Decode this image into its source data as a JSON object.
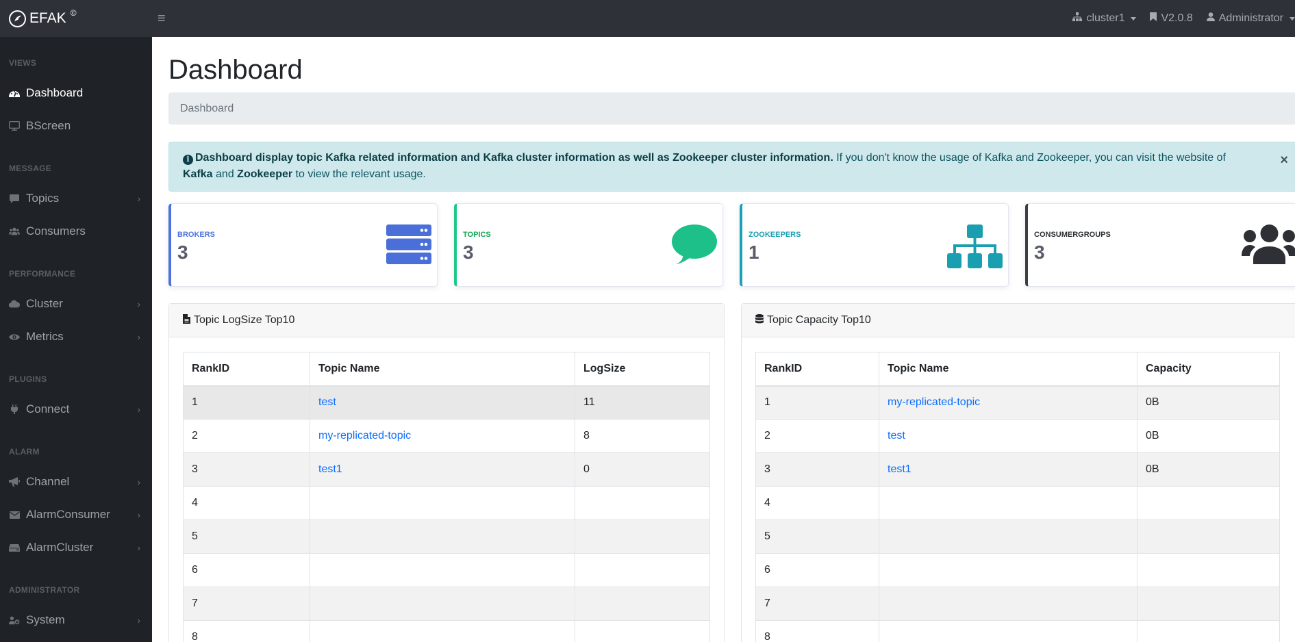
{
  "header": {
    "brand": "EFAK",
    "brand_mark": "©",
    "menu_toggle_icon": "hamburger-icon",
    "cluster": "cluster1",
    "version": "V2.0.8",
    "user": "Administrator"
  },
  "sidebar": {
    "sections": [
      {
        "heading": "VIEWS",
        "items": [
          {
            "label": "Dashboard",
            "icon": "tachometer-icon",
            "active": true,
            "expandable": false
          },
          {
            "label": "BScreen",
            "icon": "desktop-icon",
            "active": false,
            "expandable": false
          }
        ]
      },
      {
        "heading": "MESSAGE",
        "items": [
          {
            "label": "Topics",
            "icon": "comment-icon",
            "active": false,
            "expandable": true
          },
          {
            "label": "Consumers",
            "icon": "users-icon",
            "active": false,
            "expandable": false
          }
        ]
      },
      {
        "heading": "PERFORMANCE",
        "items": [
          {
            "label": "Cluster",
            "icon": "cloud-icon",
            "active": false,
            "expandable": true
          },
          {
            "label": "Metrics",
            "icon": "eye-icon",
            "active": false,
            "expandable": true
          }
        ]
      },
      {
        "heading": "PLUGINS",
        "items": [
          {
            "label": "Connect",
            "icon": "plug-icon",
            "active": false,
            "expandable": true
          }
        ]
      },
      {
        "heading": "ALARM",
        "items": [
          {
            "label": "Channel",
            "icon": "bullhorn-icon",
            "active": false,
            "expandable": true
          },
          {
            "label": "AlarmConsumer",
            "icon": "envelope-icon",
            "active": false,
            "expandable": true
          },
          {
            "label": "AlarmCluster",
            "icon": "hdd-icon",
            "active": false,
            "expandable": true
          }
        ]
      },
      {
        "heading": "ADMINISTRATOR",
        "items": [
          {
            "label": "System",
            "icon": "user-cog-icon",
            "active": false,
            "expandable": true
          }
        ]
      }
    ]
  },
  "main": {
    "title": "Dashboard",
    "breadcrumb": "Dashboard",
    "alert": {
      "bold_intro": "Dashboard display topic Kafka related information and Kafka cluster information as well as Zookeeper cluster information.",
      "text_1": " If you don't know the usage of Kafka and Zookeeper, you can visit the website of ",
      "link_kafka": "Kafka",
      "text_2": " and ",
      "link_zookeeper": "Zookeeper",
      "text_3": " to view the relevant usage.",
      "close": "×"
    },
    "cards": [
      {
        "label": "BROKERS",
        "value": "3",
        "color": "#4e73df",
        "icon": "server-icon"
      },
      {
        "label": "TOPICS",
        "value": "3",
        "color": "#1cc88a",
        "icon": "comment-icon"
      },
      {
        "label": "ZOOKEEPERS",
        "value": "1",
        "color": "#1a9fb0",
        "icon": "sitemap-icon"
      },
      {
        "label": "CONSUMERGROUPS",
        "value": "3",
        "color": "#3b3e45",
        "icon": "users-icon"
      }
    ],
    "logsize_panel": {
      "title": "Topic LogSize Top10",
      "columns": [
        "RankID",
        "Topic Name",
        "LogSize"
      ],
      "rows": [
        {
          "rank": "1",
          "topic": "test",
          "value": "11"
        },
        {
          "rank": "2",
          "topic": "my-replicated-topic",
          "value": "8"
        },
        {
          "rank": "3",
          "topic": "test1",
          "value": "0"
        },
        {
          "rank": "4",
          "topic": "",
          "value": ""
        },
        {
          "rank": "5",
          "topic": "",
          "value": ""
        },
        {
          "rank": "6",
          "topic": "",
          "value": ""
        },
        {
          "rank": "7",
          "topic": "",
          "value": ""
        },
        {
          "rank": "8",
          "topic": "",
          "value": ""
        }
      ]
    },
    "capacity_panel": {
      "title": "Topic Capacity Top10",
      "columns": [
        "RankID",
        "Topic Name",
        "Capacity"
      ],
      "rows": [
        {
          "rank": "1",
          "topic": "my-replicated-topic",
          "value": "0B"
        },
        {
          "rank": "2",
          "topic": "test",
          "value": "0B"
        },
        {
          "rank": "3",
          "topic": "test1",
          "value": "0B"
        },
        {
          "rank": "4",
          "topic": "",
          "value": ""
        },
        {
          "rank": "5",
          "topic": "",
          "value": ""
        },
        {
          "rank": "6",
          "topic": "",
          "value": ""
        },
        {
          "rank": "7",
          "topic": "",
          "value": ""
        },
        {
          "rank": "8",
          "topic": "",
          "value": ""
        }
      ]
    }
  }
}
